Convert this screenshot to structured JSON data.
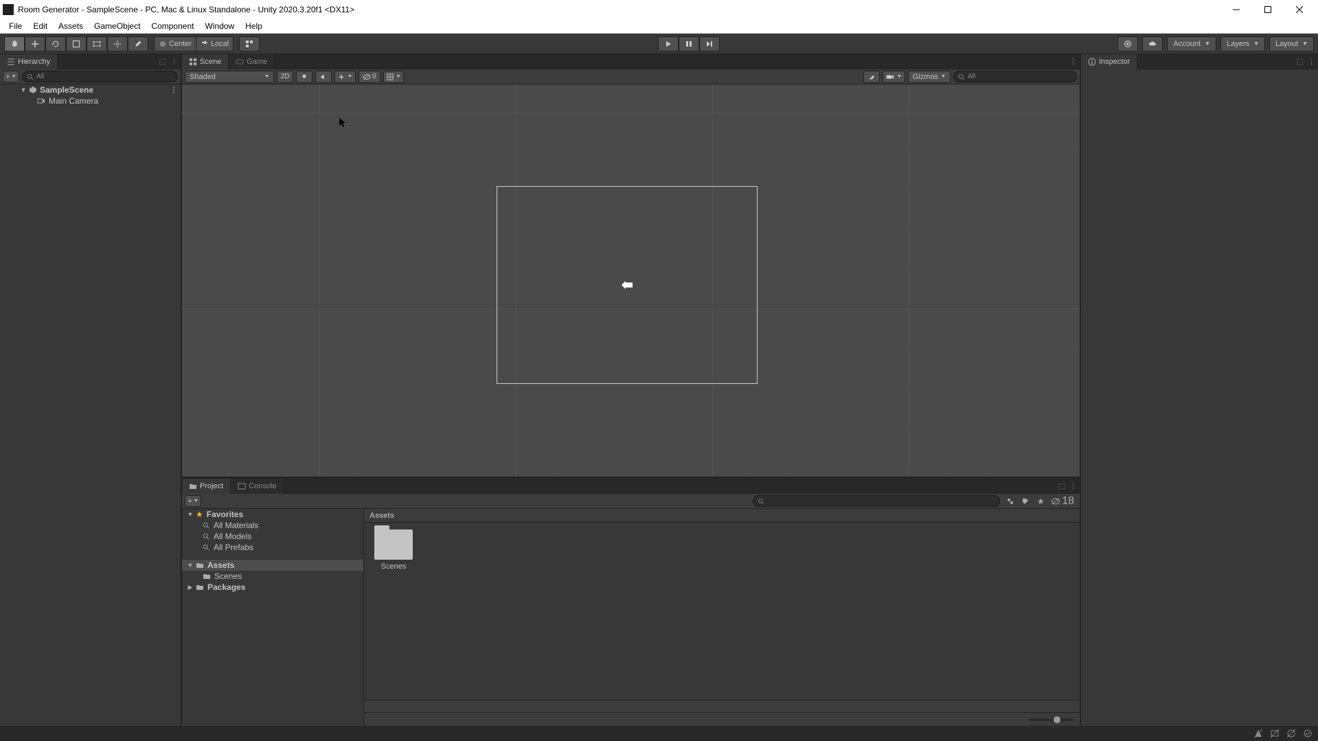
{
  "window": {
    "title": "Room Generator - SampleScene - PC, Mac & Linux Standalone - Unity 2020.3.20f1 <DX11>"
  },
  "menubar": [
    "File",
    "Edit",
    "Assets",
    "GameObject",
    "Component",
    "Window",
    "Help"
  ],
  "toolbar": {
    "pivot": "Center",
    "handle": "Local",
    "account": "Account",
    "layers": "Layers",
    "layout": "Layout"
  },
  "hierarchy": {
    "tab": "Hierarchy",
    "search_placeholder": "All",
    "scene": "SampleScene",
    "items": [
      "Main Camera"
    ]
  },
  "scene": {
    "tab_scene": "Scene",
    "tab_game": "Game",
    "shading": "Shaded",
    "mode_2d": "2D",
    "camera_count": "0",
    "gizmos": "Gizmos",
    "search_placeholder": "All"
  },
  "inspector": {
    "tab": "Inspector"
  },
  "project": {
    "tab_project": "Project",
    "tab_console": "Console",
    "favorites": "Favorites",
    "fav_items": [
      "All Materials",
      "All Models",
      "All Prefabs"
    ],
    "assets": "Assets",
    "asset_children": [
      "Scenes"
    ],
    "packages": "Packages",
    "breadcrumb": "Assets",
    "grid_items": [
      "Scenes"
    ],
    "hidden_count": "18"
  }
}
